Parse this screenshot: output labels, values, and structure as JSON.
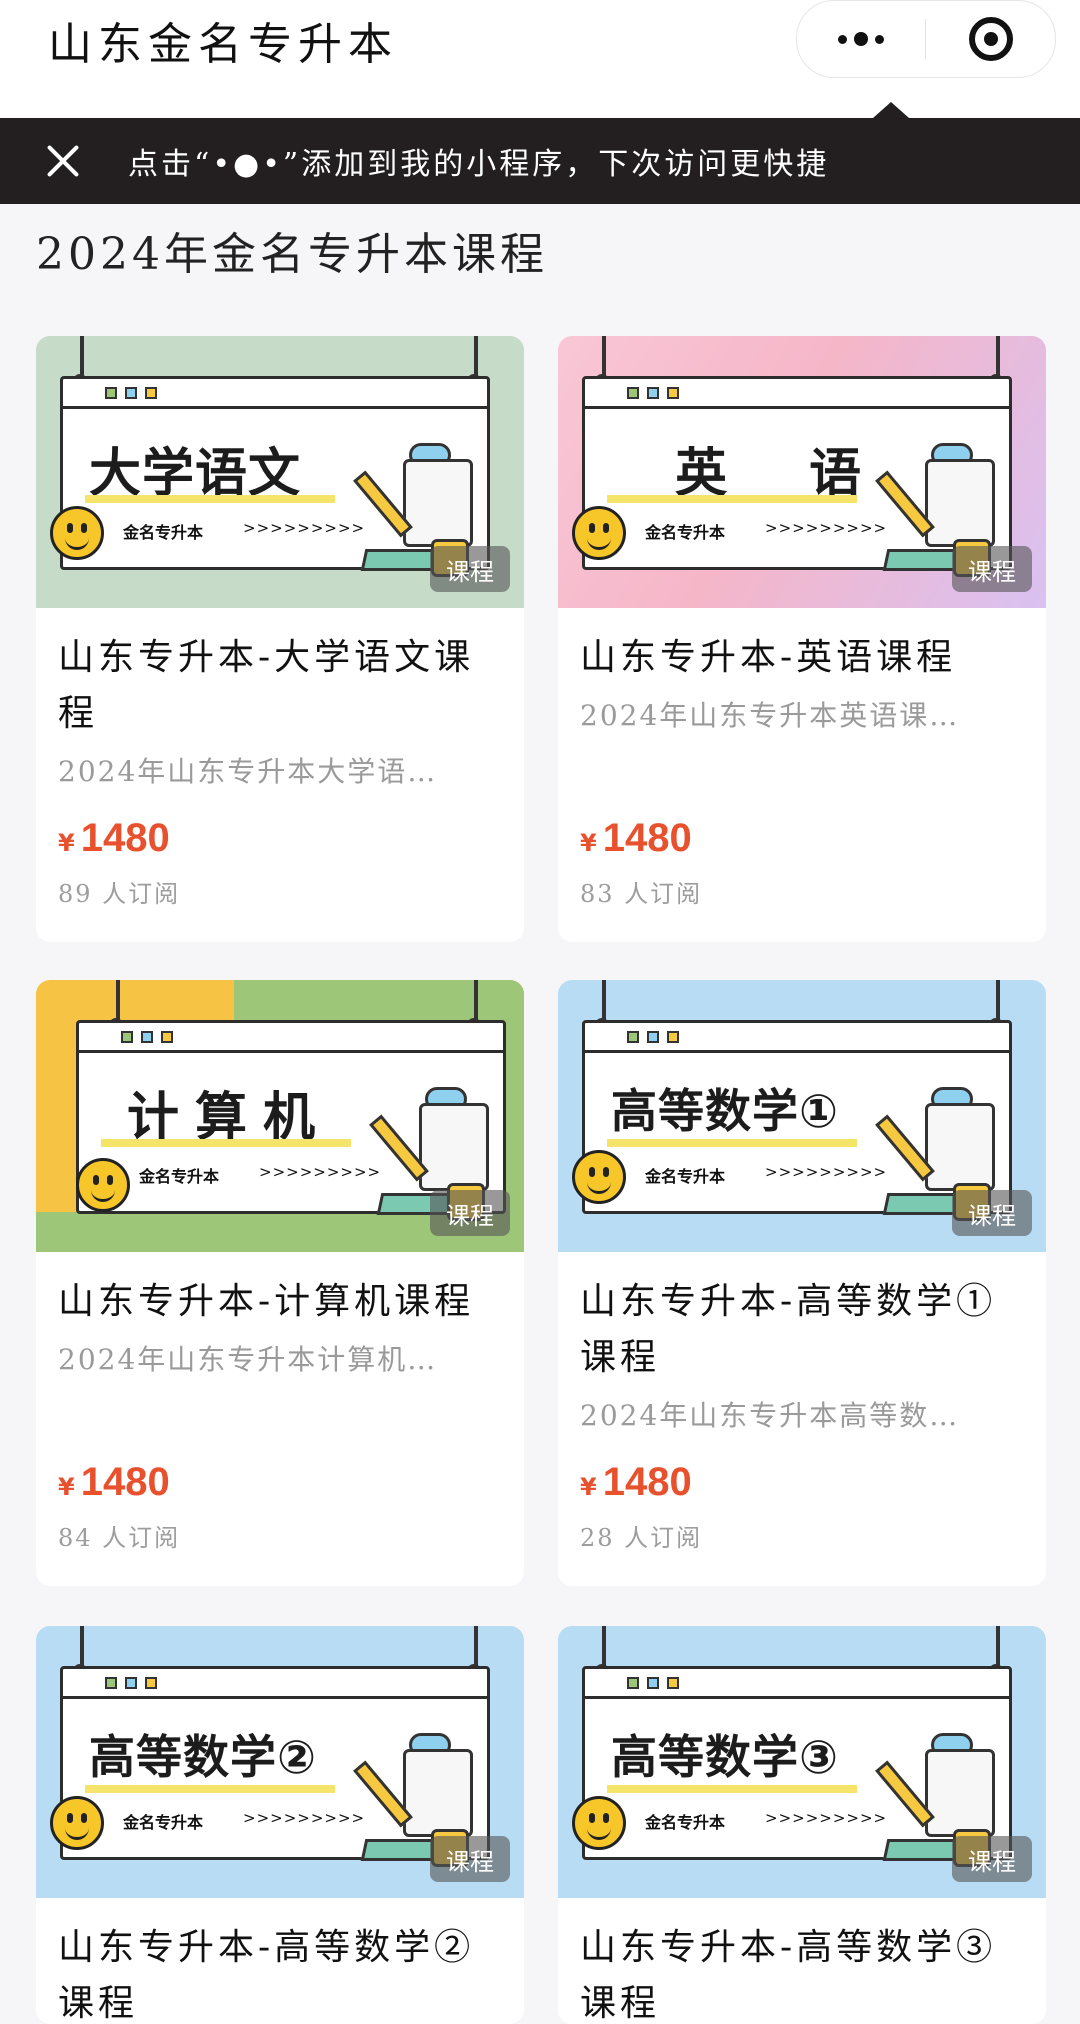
{
  "header": {
    "app_title": "山东金名专升本",
    "more_icon": "more-dots-icon",
    "close_icon": "close-miniprogram-icon"
  },
  "tip": {
    "text": "点击“•●•”添加到我的小程序，下次访问更快捷",
    "close_icon": "close-icon"
  },
  "section_title": "2024年金名专升本课程",
  "cover_common": {
    "brand": "金名专升本",
    "arrows": ">>>>>>>>>",
    "tag": "课程"
  },
  "courses": [
    {
      "cover_title": "大学语文",
      "name": "山东专升本-大学语文课程",
      "desc": "2024年山东专升本大学语…",
      "currency": "¥",
      "price": "1480",
      "subscribers": "89 人订阅"
    },
    {
      "cover_title": "英 语",
      "name": "山东专升本-英语课程",
      "desc": "2024年山东专升本英语课…",
      "currency": "¥",
      "price": "1480",
      "subscribers": "83 人订阅"
    },
    {
      "cover_title": "计算机",
      "name": "山东专升本-计算机课程",
      "desc": "2024年山东专升本计算机…",
      "currency": "¥",
      "price": "1480",
      "subscribers": "84 人订阅"
    },
    {
      "cover_title": "高等数学①",
      "name": "山东专升本-高等数学①课程",
      "desc": "2024年山东专升本高等数…",
      "currency": "¥",
      "price": "1480",
      "subscribers": "28 人订阅"
    },
    {
      "cover_title": "高等数学②",
      "name": "山东专升本-高等数学②课程"
    },
    {
      "cover_title": "高等数学③",
      "name": "山东专升本-高等数学③课程"
    }
  ],
  "colors": {
    "price": "#e8512e",
    "tipbar": "#231f20"
  }
}
